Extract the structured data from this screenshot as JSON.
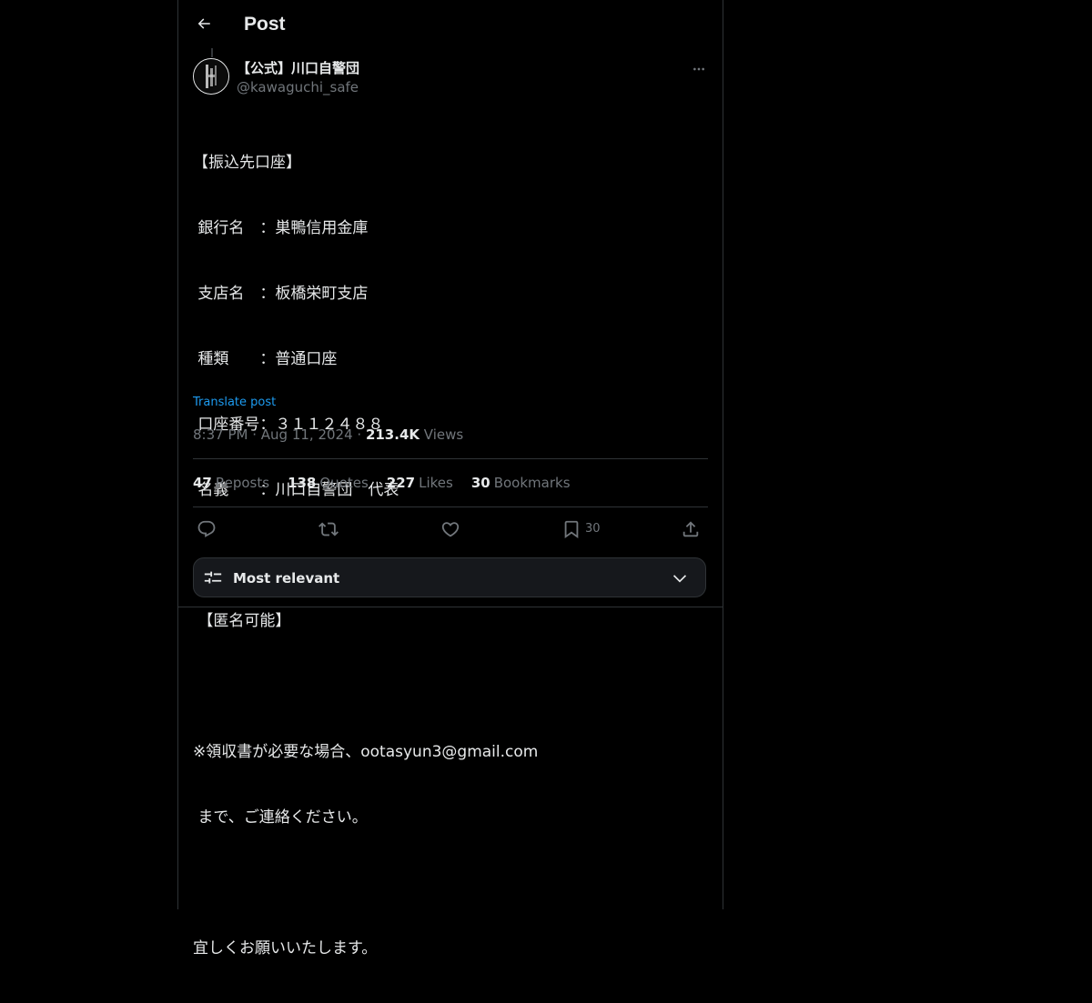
{
  "header": {
    "title": "Post"
  },
  "author": {
    "display_name": "【公式】川口自警団",
    "handle": "@kawaguchi_safe"
  },
  "post": {
    "lines": [
      "【振込先口座】",
      " 銀行名　：巣鴨信用金庫",
      " 支店名　：板橋栄町支店",
      " 種類　　：普通口座",
      " 口座番号：３１１２４８８",
      " 名義　　：川口自警団　代表",
      "",
      " 【匿名可能】",
      "",
      "※領収書が必要な場合、ootasyun3@gmail.com",
      " まで、ご連絡ください。",
      "",
      "宜しくお願いいたします。"
    ],
    "translate_label": "Translate post"
  },
  "meta": {
    "time": "8:37 PM",
    "sep1": " · ",
    "date": "Aug 11, 2024",
    "sep2": " · ",
    "views_count": "213.4K",
    "views_label": " Views"
  },
  "stats": [
    {
      "count": "47",
      "label": "Reposts"
    },
    {
      "count": "138",
      "label": "Quotes"
    },
    {
      "count": "227",
      "label": "Likes"
    },
    {
      "count": "30",
      "label": "Bookmarks"
    }
  ],
  "actions": {
    "bookmark_count": "30"
  },
  "sort": {
    "label": "Most relevant"
  },
  "colors": {
    "background": "#000000",
    "text": "#e7e9ea",
    "secondary": "#71767b",
    "link": "#1d9bf0",
    "border": "#2f3336"
  },
  "icons": {
    "back": "arrow-left-icon",
    "more": "more-horizontal-icon",
    "reply": "reply-icon",
    "repost": "repost-icon",
    "like": "heart-icon",
    "bookmark": "bookmark-icon",
    "share": "share-icon",
    "sort": "sliders-icon",
    "chevron": "chevron-down-icon"
  }
}
